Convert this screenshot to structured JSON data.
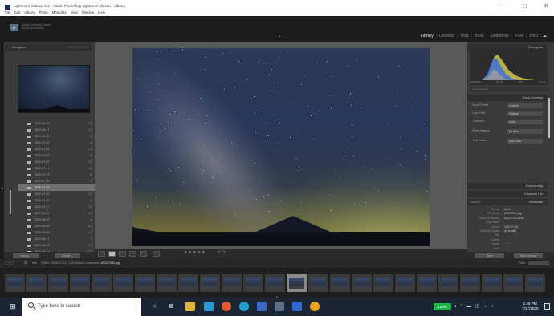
{
  "window": {
    "title": "Lightroom Catalog-2-2 - Adobe Photoshop Lightroom Classic - Library",
    "menu": [
      "File",
      "Edit",
      "Library",
      "Photo",
      "Metadata",
      "View",
      "Window",
      "Help"
    ],
    "minimize": "–",
    "maximize": "□",
    "close": "✕"
  },
  "identity": {
    "badge": "Lr",
    "line1": "Adobe Lightroom Classic",
    "line2": "Adobe Anonymous"
  },
  "modules": [
    "Library",
    "Develop",
    "Map",
    "Book",
    "Slideshow",
    "Print",
    "Web"
  ],
  "active_module": "Library",
  "left_panel": {
    "navigator_title": "Navigator",
    "navigator_options": "FIT  FILL  1:1  3:1",
    "folders": [
      {
        "name": "2020-06-15",
        "count": "13"
      },
      {
        "name": "2020-06-17",
        "count": "11"
      },
      {
        "name": "2020-06-25",
        "count": "6"
      },
      {
        "name": "2020-07-01",
        "count": "4"
      },
      {
        "name": "2020-07-04",
        "count": "14"
      },
      {
        "name": "2020-07-06",
        "count": "6"
      },
      {
        "name": "2020-07-07",
        "count": "25"
      },
      {
        "name": "2020-07-11",
        "count": "48"
      },
      {
        "name": "2020-07-13",
        "count": "8"
      },
      {
        "name": "2020-07-15",
        "count": "3"
      },
      {
        "name": "2020-07-16",
        "count": "138"
      },
      {
        "name": "2020-07-18",
        "count": "12"
      },
      {
        "name": "2020-07-20",
        "count": "5"
      },
      {
        "name": "2020-07-27",
        "count": "11"
      },
      {
        "name": "2020-08-01",
        "count": "42"
      },
      {
        "name": "2020-08-03",
        "count": "9"
      },
      {
        "name": "2020-08-06",
        "count": "61"
      },
      {
        "name": "2020-08-08",
        "count": "17"
      },
      {
        "name": "2020-08-11",
        "count": "7"
      },
      {
        "name": "2020-08-13",
        "count": "23"
      },
      {
        "name": "2020-08-14",
        "count": "102"
      },
      {
        "name": "2020-08-17",
        "count": "6"
      },
      {
        "name": "2020-08-19",
        "count": "14"
      }
    ],
    "selected_index": 10,
    "import_button": "Import...",
    "export_button": "Export..."
  },
  "toolbar": {
    "rating": "★★★★★"
  },
  "right_panel": {
    "histogram_title": "Histogram",
    "histogram_info": [
      "ISO 6400",
      "24 mm",
      "f/2.8",
      "20 sec"
    ],
    "original_photo": "Original Photo",
    "quick_develop_title": "Quick Develop",
    "quick_develop": [
      {
        "label": "Saved Preset",
        "value": "Custom"
      },
      {
        "label": "Crop Ratio",
        "value": "Original"
      },
      {
        "label": "Treatment",
        "value": "Color"
      },
      {
        "label": "White Balance",
        "value": "As Shot"
      },
      {
        "label": "Tone Control",
        "value": "Auto Tone"
      }
    ],
    "keywording_title": "Keywording",
    "keyword_list_title": "Keyword List",
    "metadata_title": "Metadata",
    "metadata_preset": "Default",
    "metadata": [
      {
        "label": "Preset",
        "value": "None"
      },
      {
        "label": "File Name",
        "value": "DSC07341.jpg"
      },
      {
        "label": "Original Filename",
        "value": "DSC07341.ARW"
      },
      {
        "label": "Copy Name",
        "value": ""
      },
      {
        "label": "Folder",
        "value": "2020-07-16"
      },
      {
        "label": "Metadata Status",
        "value": "Up to date"
      },
      {
        "label": "Title",
        "value": ""
      },
      {
        "label": "Caption",
        "value": ""
      },
      {
        "label": "Rating",
        "value": "· · · · ·"
      },
      {
        "label": "Label",
        "value": ""
      }
    ],
    "sync_button": "Sync",
    "sync_settings_button": "Sync Settings"
  },
  "filmstrip": {
    "source": "Folder : 2020-07-16",
    "count_text": "138 photos / 1 selected /",
    "selected_file": "DSC07341.jpg",
    "filter_label": "Filter :"
  },
  "taskbar": {
    "search_placeholder": "Type here to search",
    "battery": "100%",
    "time": "1:48 PM",
    "date": "7/17/2020"
  }
}
